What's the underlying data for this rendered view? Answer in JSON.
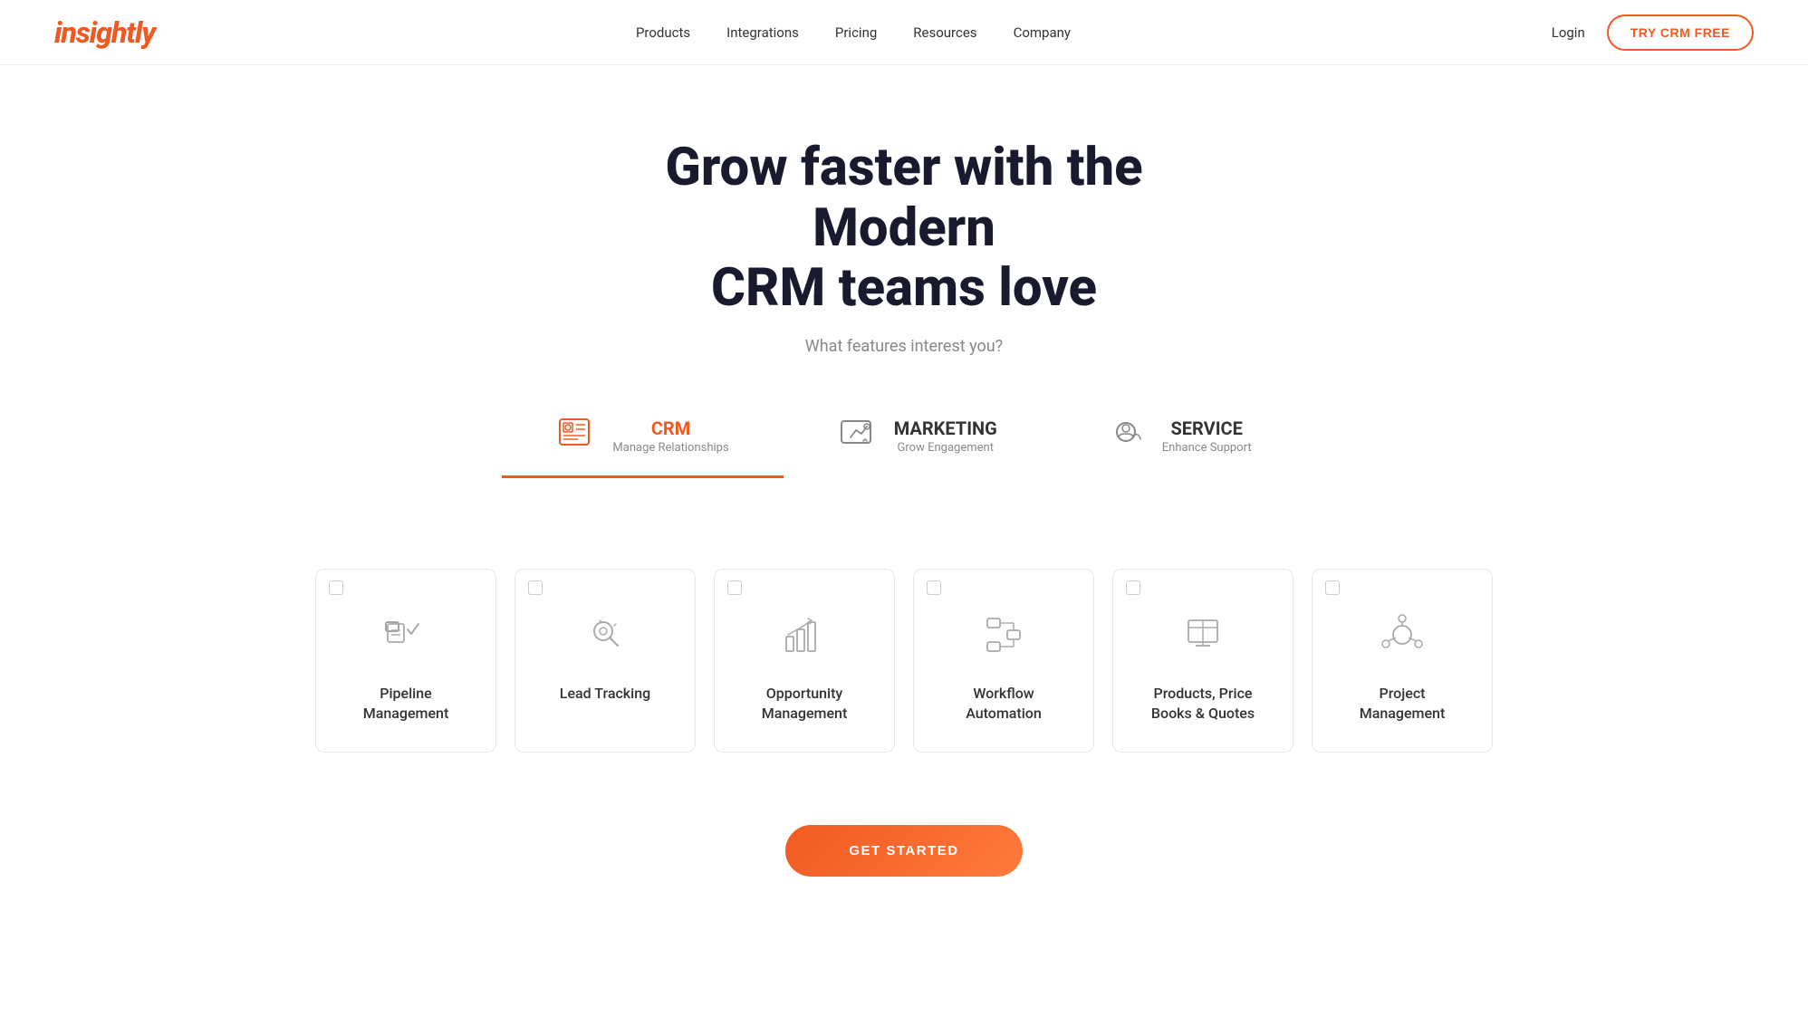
{
  "brand": {
    "logo": "insightly"
  },
  "nav": {
    "links": [
      {
        "id": "products",
        "label": "Products"
      },
      {
        "id": "integrations",
        "label": "Integrations"
      },
      {
        "id": "pricing",
        "label": "Pricing"
      },
      {
        "id": "resources",
        "label": "Resources"
      },
      {
        "id": "company",
        "label": "Company"
      }
    ],
    "login_label": "Login",
    "try_label": "TRY CRM FREE"
  },
  "hero": {
    "heading_line1": "Grow faster with the Modern",
    "heading_line2": "CRM teams love",
    "subtitle": "What features interest you?"
  },
  "tabs": [
    {
      "id": "crm",
      "title": "CRM",
      "subtitle": "Manage Relationships",
      "active": true
    },
    {
      "id": "marketing",
      "title": "MARKETING",
      "subtitle": "Grow Engagement",
      "active": false
    },
    {
      "id": "service",
      "title": "SERVICE",
      "subtitle": "Enhance Support",
      "active": false
    }
  ],
  "cards": [
    {
      "id": "pipeline",
      "label_line1": "Pipeline",
      "label_line2": "Management",
      "icon": "pipeline"
    },
    {
      "id": "lead-tracking",
      "label_line1": "Lead Tracking",
      "label_line2": "",
      "icon": "lead"
    },
    {
      "id": "opportunity",
      "label_line1": "Opportunity",
      "label_line2": "Management",
      "icon": "opportunity"
    },
    {
      "id": "workflow",
      "label_line1": "Workflow",
      "label_line2": "Automation",
      "icon": "workflow"
    },
    {
      "id": "price-books",
      "label_line1": "Products, Price",
      "label_line2": "Books & Quotes",
      "icon": "pricebook"
    },
    {
      "id": "project",
      "label_line1": "Project",
      "label_line2": "Management",
      "icon": "project"
    }
  ],
  "cta": {
    "button_label": "GET STARTED"
  }
}
